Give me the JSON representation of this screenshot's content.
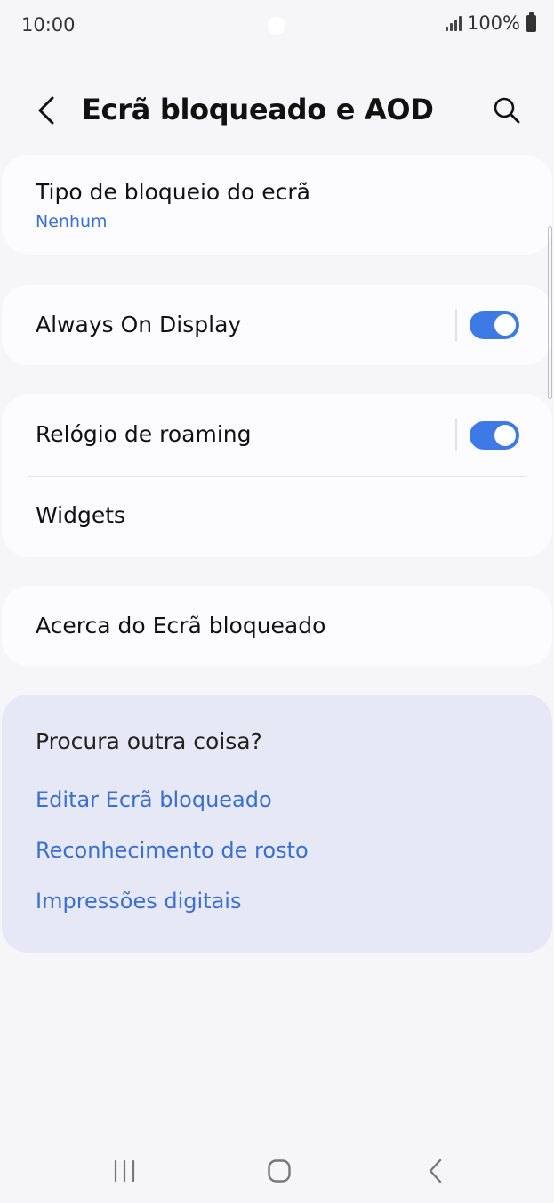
{
  "status_bar": {
    "time": "10:00",
    "battery": "100%",
    "icons": [
      "signal-icon",
      "battery-icon"
    ]
  },
  "header": {
    "title": "Ecrã bloqueado e AOD",
    "back_icon": "back-chevron-icon",
    "search_icon": "search-icon"
  },
  "settings": {
    "lock_type": {
      "title": "Tipo de bloqueio do ecrã",
      "value": "Nenhum"
    },
    "always_on_display": {
      "title": "Always On Display",
      "enabled": true
    },
    "roaming_clock": {
      "title": "Relógio de roaming",
      "enabled": true
    },
    "widgets": {
      "title": "Widgets"
    },
    "about": {
      "title": "Acerca do Ecrã bloqueado"
    }
  },
  "suggestions": {
    "title": "Procura outra coisa?",
    "links": [
      "Editar Ecrã bloqueado",
      "Reconhecimento de rosto",
      "Impressões digitais"
    ]
  },
  "navigation": {
    "icons": [
      "recents-icon",
      "home-icon",
      "back-icon"
    ]
  },
  "colors": {
    "accent": "#3e7ae6",
    "link": "#3a6fd0",
    "background": "#f6f6f8",
    "card": "#fcfcfe",
    "suggest_card": "#e6e8f6"
  }
}
